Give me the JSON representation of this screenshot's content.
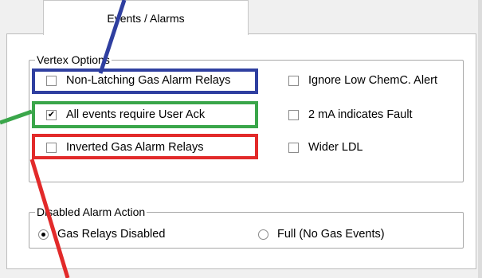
{
  "tab": {
    "label": "Events / Alarms"
  },
  "vertex_options": {
    "legend": "Vertex Options",
    "left": [
      {
        "label": "Non-Latching Gas Alarm Relays",
        "checked": false
      },
      {
        "label": "All events require User Ack",
        "checked": true
      },
      {
        "label": "Inverted Gas Alarm Relays",
        "checked": false
      }
    ],
    "right": [
      {
        "label": "Ignore Low ChemC. Alert",
        "checked": false
      },
      {
        "label": "2 mA indicates Fault",
        "checked": false
      },
      {
        "label": "Wider LDL",
        "checked": false
      }
    ]
  },
  "disabled_alarm_action": {
    "legend": "Disabled Alarm Action",
    "options": [
      {
        "label": "Gas Relays Disabled",
        "selected": true
      },
      {
        "label": "Full (No Gas Events)",
        "selected": false
      }
    ]
  },
  "colors": {
    "highlight_blue": "#2f3fa0",
    "highlight_green": "#3aa64a",
    "highlight_red": "#e22a2a"
  }
}
